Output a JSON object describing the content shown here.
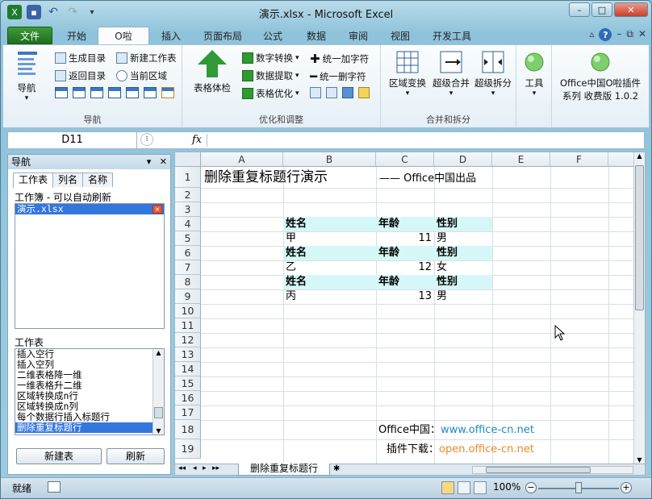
{
  "window": {
    "title": "演示.xlsx - Microsoft Excel",
    "minimize": "–",
    "maximize": "□",
    "close": "✕"
  },
  "tabs": [
    {
      "label": "文件"
    },
    {
      "label": "开始"
    },
    {
      "label": "O啦"
    },
    {
      "label": "插入"
    },
    {
      "label": "页面布局"
    },
    {
      "label": "公式"
    },
    {
      "label": "数据"
    },
    {
      "label": "审阅"
    },
    {
      "label": "视图"
    },
    {
      "label": "开发工具"
    }
  ],
  "ribbon": {
    "nav_group": {
      "label": "导航",
      "big_button": "导航",
      "gen_toc": "生成目录",
      "new_sheet": "新建工作表",
      "back_toc": "返回目录",
      "cur_region": "当前区域"
    },
    "opt_group": {
      "label": "优化和调整",
      "big_button": "表格体检",
      "num_convert": "数字转换",
      "data_extract": "数据提取",
      "table_opt": "表格优化",
      "add_char": "统一加字符",
      "del_char": "统一删字符"
    },
    "merge_group": {
      "label": "合并和拆分",
      "region_transform": "区域变换",
      "super_merge": "超级合并",
      "super_split": "超级拆分"
    },
    "tools": {
      "label": "工具"
    },
    "plugin": {
      "line1": "Office中国O啦插件",
      "line2": "系列 收费版 1.0.2"
    }
  },
  "formula_bar": {
    "name_box": "D11",
    "fx": "fx",
    "value": ""
  },
  "nav_pane": {
    "title": "导航",
    "tabs": [
      "工作表",
      "列名",
      "名称"
    ],
    "workbook_caption": "工作簿 - 可以自动刷新",
    "workbooks": [
      "演示.xlsx"
    ],
    "sheets_caption": "工作表",
    "sheets": [
      "插入空行",
      "插入空列",
      "二维表格降一维",
      "一维表格升二维",
      "区域转换成n行",
      "区域转换成n列",
      "每个数据行插入标题行",
      "删除重复标题行"
    ],
    "new_button": "新建表",
    "refresh_button": "刷新"
  },
  "sheet": {
    "columns": [
      "A",
      "B",
      "C",
      "D",
      "E",
      "F"
    ],
    "rows": [
      "1",
      "2",
      "3",
      "4",
      "5",
      "6",
      "7",
      "8",
      "9",
      "10",
      "11",
      "12",
      "13",
      "14",
      "15",
      "16",
      "17",
      "18",
      "19"
    ],
    "title": "删除重复标题行演示",
    "subtitle": "—— Office中国出品",
    "header_name": "姓名",
    "header_age": "年龄",
    "header_gender": "性别",
    "records": [
      {
        "name": "甲",
        "age": "11",
        "gender": "男"
      },
      {
        "name": "乙",
        "age": "12",
        "gender": "女"
      },
      {
        "name": "丙",
        "age": "13",
        "gender": "男"
      }
    ],
    "office_label": "Office中国：",
    "office_url": "www.office-cn.net",
    "plugin_label": "插件下载：",
    "plugin_url": "open.office-cn.net",
    "active_tab": "删除重复标题行"
  },
  "status": {
    "ready": "就绪",
    "zoom": "100%"
  }
}
